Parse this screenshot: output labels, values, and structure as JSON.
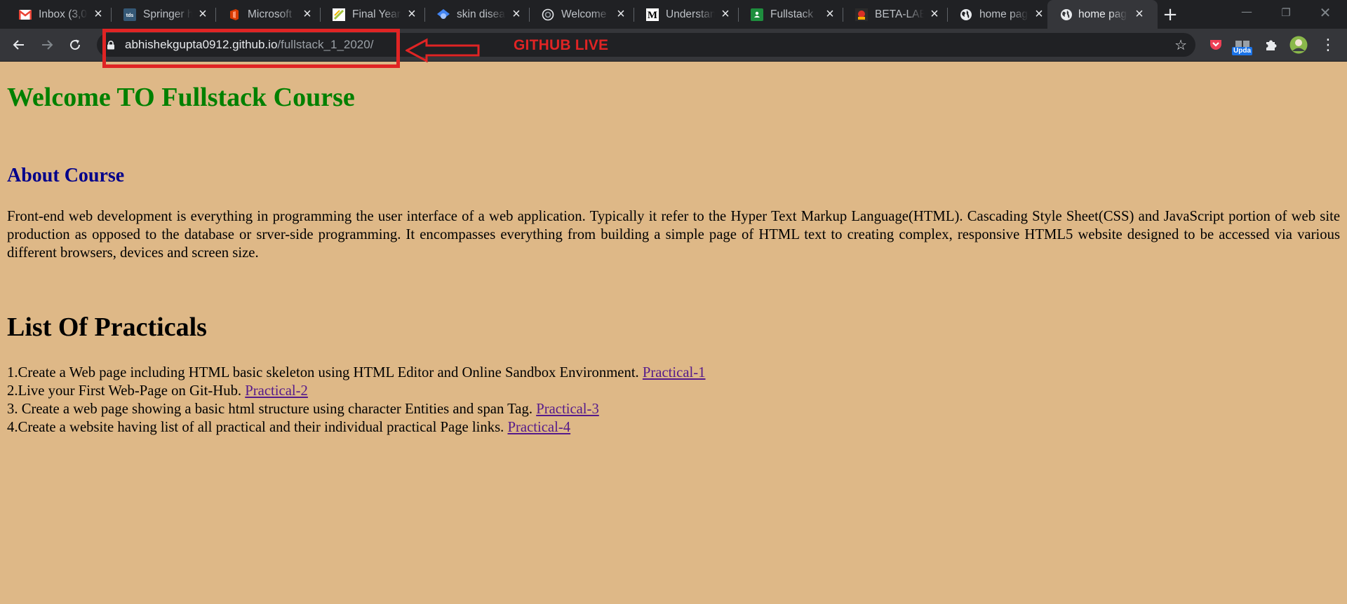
{
  "browser": {
    "tabs": [
      {
        "title": "Inbox (3,0",
        "icon": "gmail-icon",
        "active": false
      },
      {
        "title": "Springer h",
        "icon": "tds-icon",
        "active": false
      },
      {
        "title": "Microsoft",
        "icon": "office-icon",
        "active": false
      },
      {
        "title": "Final Year",
        "icon": "notebook-icon",
        "active": false
      },
      {
        "title": "skin disea",
        "icon": "scholar-icon",
        "active": false
      },
      {
        "title": "Welcome",
        "icon": "globe-outline-icon",
        "active": false
      },
      {
        "title": "Understan",
        "icon": "medium-icon",
        "active": false
      },
      {
        "title": "Fullstack",
        "icon": "classroom-icon",
        "active": false
      },
      {
        "title": "BETA-LAB",
        "icon": "beta-lab-icon",
        "active": false
      },
      {
        "title": "home pag",
        "icon": "globe-icon",
        "active": false
      },
      {
        "title": "home pag",
        "icon": "globe-icon",
        "active": true
      }
    ],
    "url_host": "abhishekgupta0912.github.io",
    "url_path": "/fullstack_1_2020/",
    "update_badge": "Upda",
    "colors": {
      "tabstrip": "#202124",
      "toolbar": "#35363a",
      "omnibox": "#202124"
    }
  },
  "annotation": {
    "label": "GITHUB LIVE",
    "color": "#e02424"
  },
  "page": {
    "title": "Welcome TO Fullstack Course",
    "about_heading": "About Course",
    "about_text": "Front-end web development is everything in programming the user interface of a web application. Typically it refer to the Hyper Text Markup Language(HTML). Cascading Style Sheet(CSS) and JavaScript portion of web site production as opposed to the database or srver-side programming. It encompasses everything from building a simple page of HTML text to creating complex, responsive HTML5 website designed to be accessed via various different browsers, devices and screen size.",
    "practicals_heading": "List Of Practicals",
    "practicals": [
      {
        "text": "1.Create a Web page including HTML basic skeleton using HTML Editor and Online Sandbox Environment. ",
        "link": "Practical-1"
      },
      {
        "text": "2.Live your First Web-Page on Git-Hub. ",
        "link": "Practical-2"
      },
      {
        "text": "3. Create a web page showing a basic html structure using character Entities and span Tag. ",
        "link": "Practical-3"
      },
      {
        "text": "4.Create a website having list of all practical and their individual practical Page links. ",
        "link": "Practical-4"
      }
    ],
    "colors": {
      "background": "#deb887",
      "title": "#008000",
      "about_heading": "#00008b",
      "link": "#551a8b"
    }
  }
}
